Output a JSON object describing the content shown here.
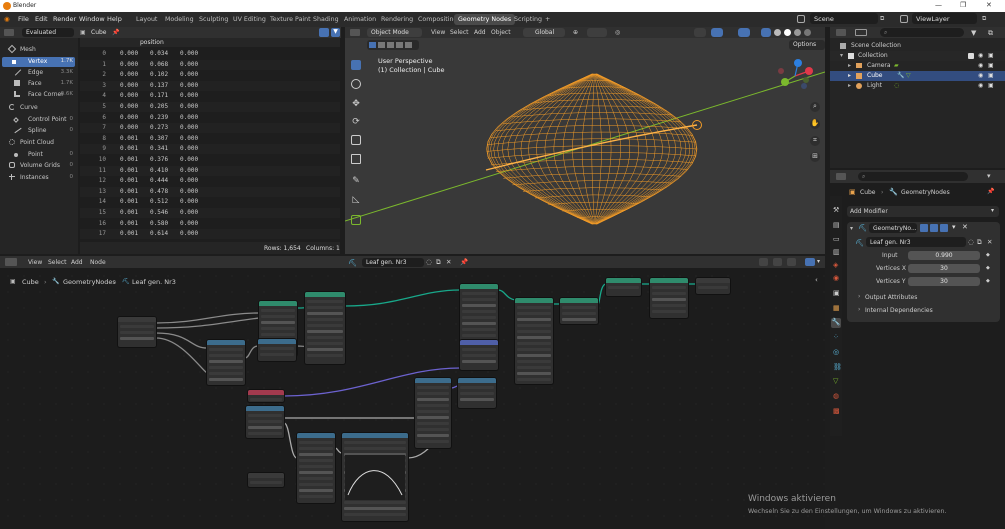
{
  "app": {
    "title": "Blender"
  },
  "menu": [
    "File",
    "Edit",
    "Render",
    "Window",
    "Help"
  ],
  "workspaces": [
    "Layout",
    "Modeling",
    "Sculpting",
    "UV Editing",
    "Texture Paint",
    "Shading",
    "Animation",
    "Rendering",
    "Compositing",
    "Geometry Nodes",
    "Scripting",
    "+"
  ],
  "active_workspace": "Geometry Nodes",
  "scene": {
    "name": "Scene",
    "view_layer": "ViewLayer"
  },
  "spreadsheet": {
    "evaluated": "Evaluated",
    "object": "Cube",
    "nav": [
      {
        "label": "Mesh",
        "count": ""
      },
      {
        "label": "Vertex",
        "count": "1.7K"
      },
      {
        "label": "Edge",
        "count": "3.3K"
      },
      {
        "label": "Face",
        "count": "1.7K"
      },
      {
        "label": "Face Corner",
        "count": "6.6K"
      },
      {
        "label": "Curve",
        "count": ""
      },
      {
        "label": "Control Point",
        "count": "0"
      },
      {
        "label": "Spline",
        "count": "0"
      },
      {
        "label": "Point Cloud",
        "count": ""
      },
      {
        "label": "Point",
        "count": "0"
      },
      {
        "label": "Volume Grids",
        "count": "0"
      },
      {
        "label": "Instances",
        "count": "0"
      }
    ],
    "column_header": "position",
    "rows": [
      [
        "0",
        "0.000",
        "0.034",
        "0.000"
      ],
      [
        "1",
        "0.000",
        "0.068",
        "0.000"
      ],
      [
        "2",
        "0.000",
        "0.102",
        "0.000"
      ],
      [
        "3",
        "0.000",
        "0.137",
        "0.000"
      ],
      [
        "4",
        "0.000",
        "0.171",
        "0.000"
      ],
      [
        "5",
        "0.000",
        "0.205",
        "0.000"
      ],
      [
        "6",
        "0.000",
        "0.239",
        "0.000"
      ],
      [
        "7",
        "0.000",
        "0.273",
        "0.000"
      ],
      [
        "8",
        "0.001",
        "0.307",
        "0.000"
      ],
      [
        "9",
        "0.001",
        "0.341",
        "0.000"
      ],
      [
        "10",
        "0.001",
        "0.376",
        "0.000"
      ],
      [
        "11",
        "0.001",
        "0.410",
        "0.000"
      ],
      [
        "12",
        "0.001",
        "0.444",
        "0.000"
      ],
      [
        "13",
        "0.001",
        "0.478",
        "0.000"
      ],
      [
        "14",
        "0.001",
        "0.512",
        "0.000"
      ],
      [
        "15",
        "0.001",
        "0.546",
        "0.000"
      ],
      [
        "16",
        "0.001",
        "0.580",
        "0.000"
      ],
      [
        "17",
        "0.001",
        "0.614",
        "0.000"
      ]
    ],
    "footer_rows": "Rows: 1,654",
    "footer_cols": "Columns: 1"
  },
  "viewport": {
    "mode": "Object Mode",
    "menus": [
      "View",
      "Select",
      "Add",
      "Object"
    ],
    "orientation": "Global",
    "options": "Options",
    "title": "User Perspective",
    "subtitle": "(1) Collection | Cube",
    "axis_x_color": "#e0394a",
    "axis_y_color": "#7bb82d",
    "axis_z_color": "#2c7fe0",
    "wire_color": "#f29b27"
  },
  "outliner": {
    "items": [
      {
        "label": "Scene Collection"
      },
      {
        "label": "Collection"
      },
      {
        "label": "Camera"
      },
      {
        "label": "Cube"
      },
      {
        "label": "Light"
      }
    ]
  },
  "properties": {
    "breadcrumb_obj": "Cube",
    "breadcrumb_mod": "GeometryNodes",
    "add_modifier": "Add Modifier",
    "modifier_name": "GeometryNo...",
    "node_group": "Leaf gen. Nr3",
    "inputs": [
      {
        "label": "Input",
        "value": "0.990"
      },
      {
        "label": "Vertices X",
        "value": "30"
      },
      {
        "label": "Vertices Y",
        "value": "30"
      }
    ],
    "sections": [
      "Output Attributes",
      "Internal Dependencies"
    ]
  },
  "node_editor": {
    "menus": [
      "View",
      "Select",
      "Add",
      "Node"
    ],
    "tree": "Leaf gen. Nr3",
    "breadcrumb": [
      "Cube",
      "GeometryNodes",
      "Leaf gen. Nr3"
    ]
  },
  "watermark": {
    "title": "Windows aktivieren",
    "body": "Wechseln Sie zu den Einstellungen, um Windows zu aktivieren."
  }
}
